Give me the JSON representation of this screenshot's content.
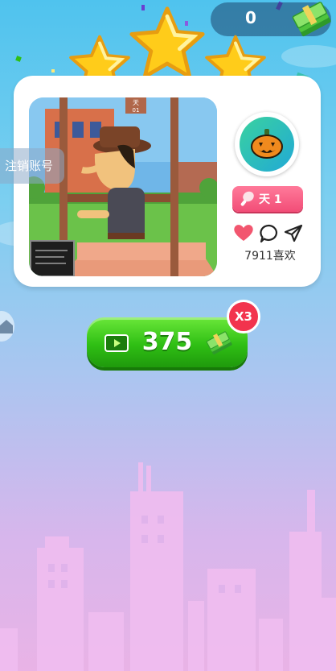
{
  "header": {
    "currency_value": "0",
    "currency_icon": "cash-stack-icon"
  },
  "stars": {
    "earned": 3,
    "total": 3
  },
  "side_menu": {
    "logout_label": "注销账号"
  },
  "post_card": {
    "photo_sign_text": "天\n01",
    "avatar_icon": "pumpkin-icon",
    "day_badge_label": "天 1",
    "day_badge_icon": "drumstick-icon",
    "likes_label": "7911喜欢",
    "actions": [
      "heart-icon",
      "comment-icon",
      "share-icon"
    ]
  },
  "reward_button": {
    "amount": "375",
    "multiplier_label": "X3",
    "video_icon": "video-icon",
    "cash_icon": "cash-stack-icon"
  },
  "colors": {
    "button_green": "#2fbf14",
    "badge_pink": "#f24d77",
    "multiplier_red": "#f2334d"
  }
}
